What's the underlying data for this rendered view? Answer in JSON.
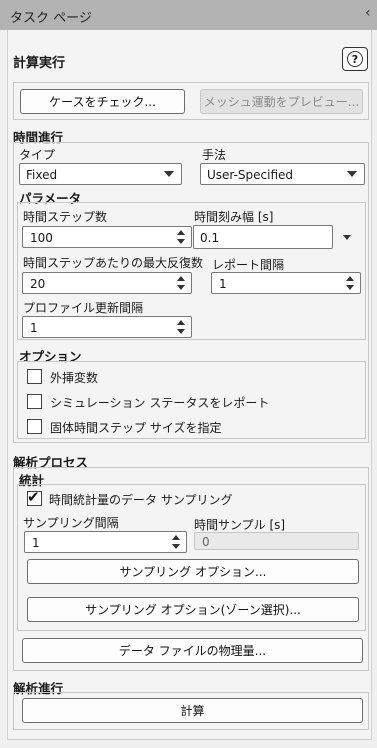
{
  "title": "タスク ページ",
  "collapse_glyph": "‹",
  "calc": {
    "header": "計算実行",
    "help_glyph": "?",
    "check_case": "ケースをチェック...",
    "preview_mesh": "メッシュ運動をプレビュー..."
  },
  "time_advance": {
    "header": "時間進行",
    "type_label": "タイプ",
    "type_value": "Fixed",
    "method_label": "手法",
    "method_value": "User-Specified"
  },
  "params": {
    "header": "パラメータ",
    "steps_label": "時間ステップ数",
    "steps_value": "100",
    "timestep_label": "時間刻み幅 [s]",
    "timestep_value": "0.1",
    "max_iter_label": "時間ステップあたりの最大反復数",
    "max_iter_value": "20",
    "report_label": "レポート間隔",
    "report_value": "1",
    "profile_label": "プロファイル更新間隔",
    "profile_value": "1"
  },
  "options": {
    "header": "オプション",
    "items": [
      {
        "label": "外挿変数",
        "checked": false
      },
      {
        "label": "シミュレーション ステータスをレポート",
        "checked": false
      },
      {
        "label": "固体時間ステップ サイズを指定",
        "checked": false
      }
    ]
  },
  "process": {
    "header": "解析プロセス",
    "stats_header": "統計",
    "sampling_check_label": "時間統計量のデータ サンプリング",
    "sampling_checked": true,
    "sampling_interval_label": "サンプリング間隔",
    "sampling_interval_value": "1",
    "time_samples_label": "時間サンプル [s]",
    "time_samples_value": "0",
    "sampling_options": "サンプリング オプション...",
    "sampling_options_zone": "サンプリング オプション(ゾーン選択)...",
    "data_file_quantities": "データ ファイルの物理量..."
  },
  "run": {
    "header": "解析進行",
    "calculate": "計算"
  },
  "check_glyph": "✔"
}
